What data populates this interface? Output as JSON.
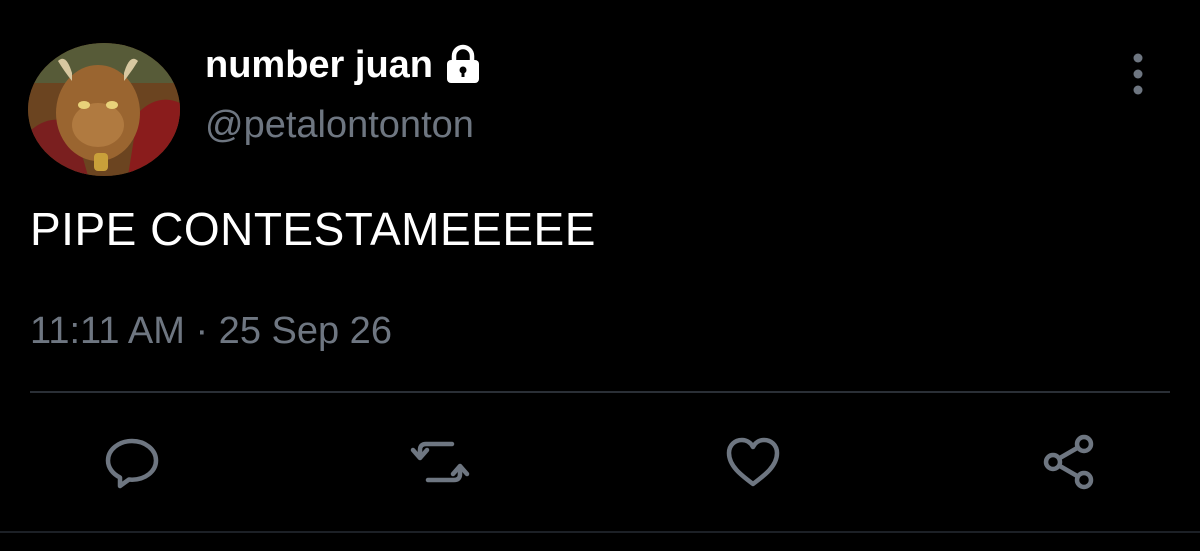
{
  "tweet": {
    "display_name": "number juan",
    "handle": "@petalontonton",
    "text": "PIPE CONTESTAMEEEEE",
    "timestamp": "11:11 AM · 25 Sep 26",
    "protected_icon": "lock-icon",
    "more_icon": "more-vertical-icon"
  },
  "actions": [
    {
      "icon": "reply-icon"
    },
    {
      "icon": "retweet-icon"
    },
    {
      "icon": "like-icon"
    },
    {
      "icon": "share-icon"
    }
  ],
  "colors": {
    "background": "#000000",
    "primary_text": "#ffffff",
    "secondary_text": "#6e7681",
    "divider": "#2a2f36"
  }
}
